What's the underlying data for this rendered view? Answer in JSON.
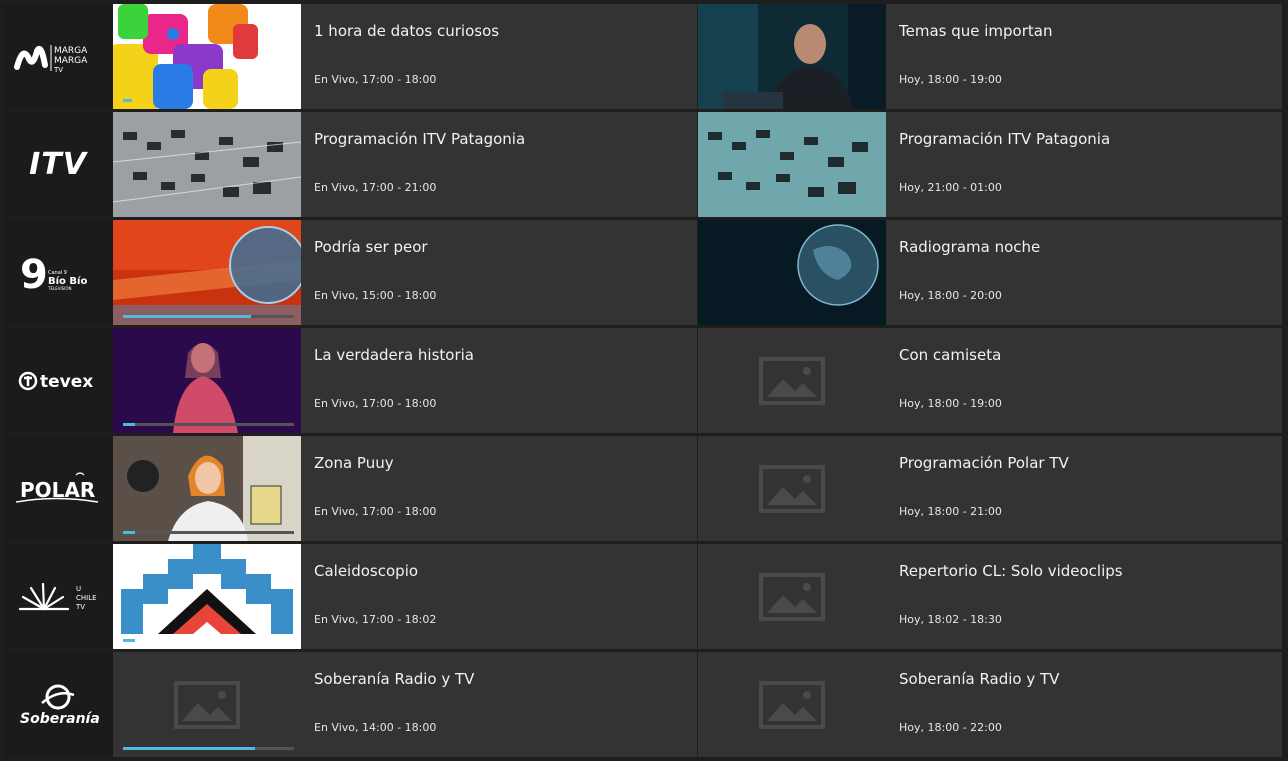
{
  "colors": {
    "row_bg": "#333333",
    "logo_bg": "#1b1b1b",
    "page_bg": "#1e1e1e",
    "progress": "#4fb9e3",
    "placeholder": "#4a4a4a"
  },
  "channels": [
    {
      "logo": {
        "icon": "marga-marga-tv-logo",
        "lines": [
          "MARGA",
          "MARGA",
          "TV"
        ]
      },
      "now": {
        "title": "1 hora de datos curiosos",
        "time": "En Vivo, 17:00 - 18:00",
        "thumb": "colorful-letters",
        "progress": 0.05
      },
      "next": {
        "title": "Temas que importan",
        "time": "Hoy, 18:00 - 19:00",
        "thumb": "man-at-desk"
      }
    },
    {
      "logo": {
        "icon": "itv-logo",
        "lines": [
          "ITV"
        ]
      },
      "now": {
        "title": "Programación ITV Patagonia",
        "time": "En Vivo, 17:00 - 21:00",
        "thumb": "mixer-console",
        "progress": 0.0
      },
      "next": {
        "title": "Programación ITV Patagonia",
        "time": "Hoy, 21:00 - 01:00",
        "thumb": "mixer-console-teal"
      }
    },
    {
      "logo": {
        "icon": "canal-9-bio-bio-logo",
        "lines": [
          "9",
          "Canal 9",
          "Bío Bío",
          "TELEVISIÓN"
        ]
      },
      "now": {
        "title": "Podría ser peor",
        "time": "En Vivo, 15:00 - 18:00",
        "thumb": "red-globe",
        "progress": 0.75
      },
      "next": {
        "title": "Radiograma noche",
        "time": "Hoy, 18:00 - 20:00",
        "thumb": "dark-earth"
      }
    },
    {
      "logo": {
        "icon": "tevex-logo",
        "lines": [
          "tevex"
        ]
      },
      "now": {
        "title": "La verdadera historia",
        "time": "En Vivo, 17:00 - 18:00",
        "thumb": "woman-purple",
        "progress": 0.07
      },
      "next": {
        "title": "Con camiseta",
        "time": "Hoy, 18:00 - 19:00",
        "thumb": "placeholder"
      }
    },
    {
      "logo": {
        "icon": "polar-logo",
        "lines": [
          "POLAR"
        ]
      },
      "now": {
        "title": "Zona Puuy",
        "time": "En Vivo, 17:00 - 18:00",
        "thumb": "girl-with-book",
        "progress": 0.07
      },
      "next": {
        "title": "Programación Polar TV",
        "time": "Hoy, 18:00 - 21:00",
        "thumb": "placeholder"
      }
    },
    {
      "logo": {
        "icon": "uchile-tv-logo",
        "lines": [
          "U",
          "CHILE",
          "TV"
        ]
      },
      "now": {
        "title": "Caleidoscopio",
        "time": "En Vivo, 17:00 - 18:02",
        "thumb": "geometric-pattern",
        "progress": 0.07
      },
      "next": {
        "title": "Repertorio CL: Solo videoclips",
        "time": "Hoy, 18:02 - 18:30",
        "thumb": "placeholder"
      }
    },
    {
      "logo": {
        "icon": "soberania-logo",
        "lines": [
          "Soberanía"
        ]
      },
      "now": {
        "title": "Soberanía Radio y TV",
        "time": "En Vivo, 14:00 - 18:00",
        "thumb": "placeholder",
        "progress": 0.77
      },
      "next": {
        "title": "Soberanía Radio y TV",
        "time": "Hoy, 18:00 - 22:00",
        "thumb": "placeholder"
      }
    }
  ]
}
